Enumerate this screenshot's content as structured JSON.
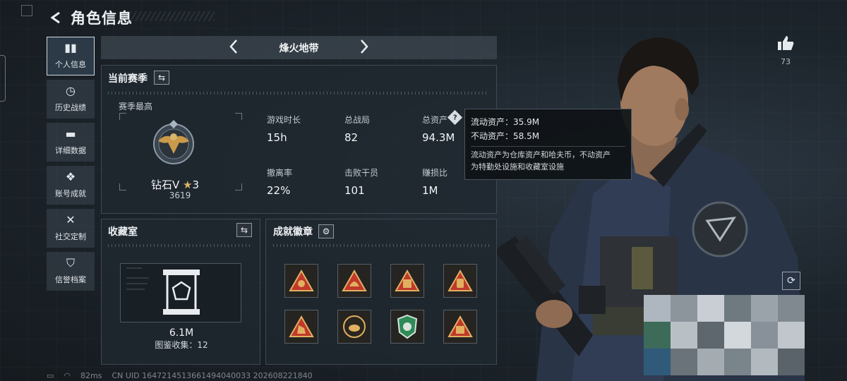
{
  "header": {
    "title": "角色信息"
  },
  "nav": [
    {
      "label": "个人信息",
      "icon": "bar-chart-icon",
      "active": true
    },
    {
      "label": "历史战绩",
      "icon": "clock-icon",
      "active": false
    },
    {
      "label": "详细数据",
      "icon": "folder-icon",
      "active": false
    },
    {
      "label": "账号成就",
      "icon": "medal-icon",
      "active": false
    },
    {
      "label": "社交定制",
      "icon": "tools-icon",
      "active": false
    },
    {
      "label": "信誉档案",
      "icon": "shield-icon",
      "active": false
    }
  ],
  "season": {
    "mode_name": "烽火地带",
    "panel_title": "当前赛季",
    "best_label": "赛季最高",
    "rank_name": "钻石V",
    "rank_stars": "3",
    "rank_score": "3619"
  },
  "stats": [
    {
      "label": "游戏时长",
      "value": "15h"
    },
    {
      "label": "总战局",
      "value": "82"
    },
    {
      "label": "总资产",
      "value": "94.3M"
    },
    {
      "label": "撤离率",
      "value": "22%"
    },
    {
      "label": "击败干员",
      "value": "101"
    },
    {
      "label": "赚损比",
      "value": "1M"
    }
  ],
  "tooltip": {
    "liquid": "流动资产：35.9M",
    "fixed": "不动资产：58.5M",
    "desc_1": "流动资产为仓库资产和哈夫币，不动资产",
    "desc_2": "为特勤处设施和收藏室设施"
  },
  "collection": {
    "title": "收藏室",
    "value": "6.1M",
    "count_text": "图鉴收集：12"
  },
  "achievements": {
    "title": "成就徽章",
    "badges": [
      "emblem-icon",
      "helmet-icon",
      "vest-icon",
      "pack-icon",
      "hand-icon",
      "orb-icon",
      "green-shield-icon",
      "crate-icon"
    ]
  },
  "likes": {
    "count": "73"
  },
  "footer": {
    "ping": "82ms",
    "uid": "CN UID 1647214513661494040033 2026082218​40"
  },
  "colors": {
    "accent_gold": "#c89a4a",
    "panel_bg": "#202830",
    "achievement_red": "#c0392b",
    "achievement_green": "#2e8b57"
  }
}
